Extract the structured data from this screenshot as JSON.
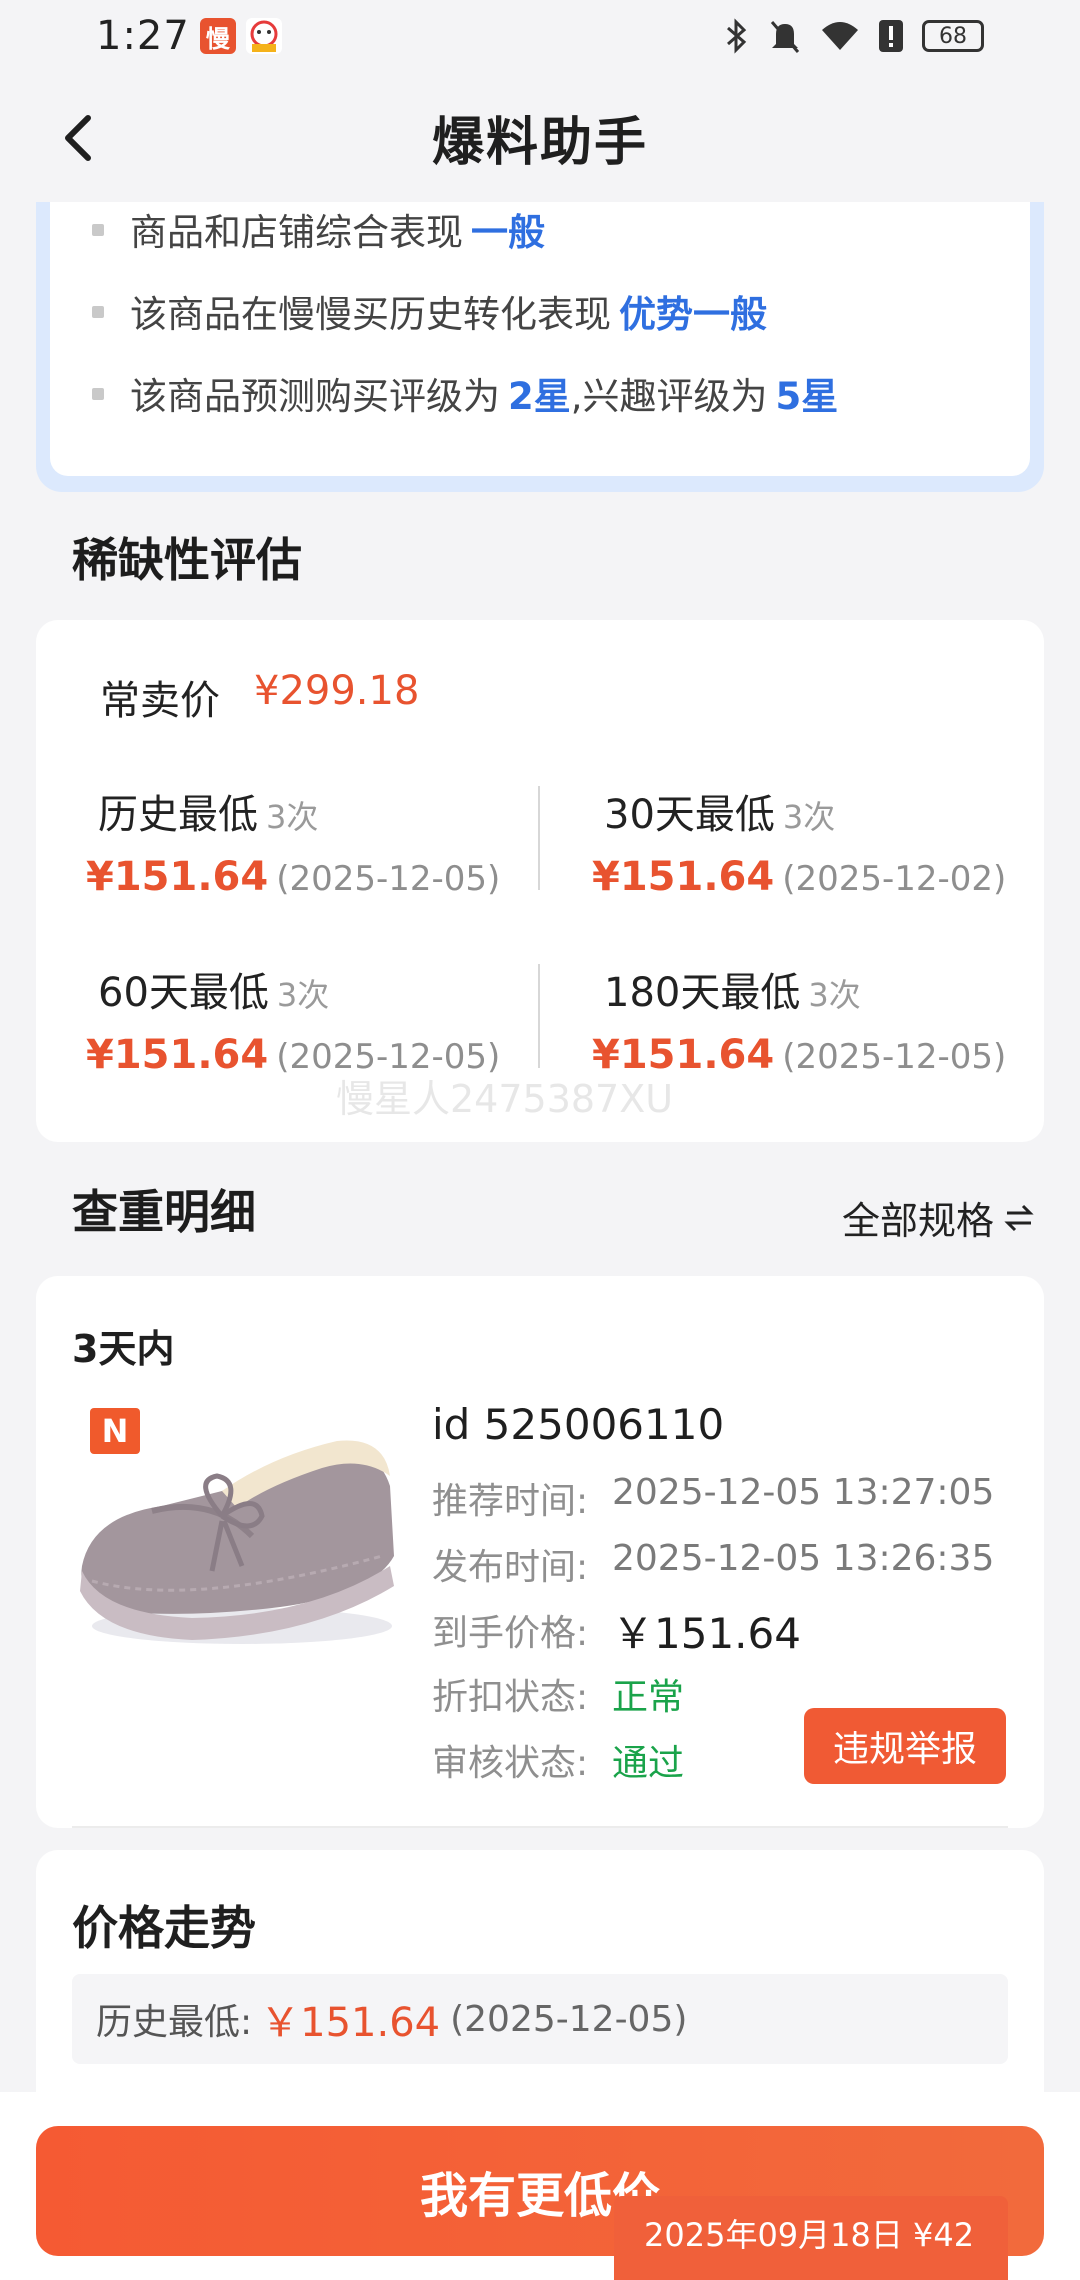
{
  "status_bar": {
    "time": "1:27",
    "battery": "68",
    "app_icon_1": "慢",
    "icons": [
      "bluetooth-icon",
      "mute-icon",
      "wifi-icon",
      "alert-icon",
      "battery-icon"
    ]
  },
  "header": {
    "title": "爆料助手"
  },
  "summary": {
    "lines": [
      {
        "text": "商品和店铺综合表现",
        "highlight": "一般"
      },
      {
        "text": "该商品在慢慢买历史转化表现",
        "highlight": "优势一般"
      },
      {
        "text_1": "该商品预测购买评级为",
        "highlight_1": "2星",
        "text_2": ",兴趣评级为",
        "highlight_2": "5星"
      }
    ]
  },
  "scarcity": {
    "title": "稀缺性评估",
    "usual_label": "常卖价",
    "usual_price": "¥299.18",
    "cells": [
      {
        "title": "历史最低",
        "count": "3次",
        "price": "¥151.64",
        "date": "(2025-12-05)"
      },
      {
        "title": "30天最低",
        "count": "3次",
        "price": "¥151.64",
        "date": "(2025-12-02)"
      },
      {
        "title": "60天最低",
        "count": "3次",
        "price": "¥151.64",
        "date": "(2025-12-05)"
      },
      {
        "title": "180天最低",
        "count": "3次",
        "price": "¥151.64",
        "date": "(2025-12-05)"
      }
    ],
    "watermark": "慢星人2475387XU"
  },
  "dedup": {
    "title": "查重明细",
    "spec_toggle": "全部规格",
    "period": "3天内",
    "badge": "N",
    "product_id": "id 525006110",
    "rows": [
      {
        "label": "推荐时间:",
        "value": "2025-12-05 13:27:05"
      },
      {
        "label": "发布时间:",
        "value": "2025-12-05 13:26:35"
      },
      {
        "label": "到手价格:",
        "value": "￥151.64"
      },
      {
        "label": "折扣状态:",
        "value": "正常"
      },
      {
        "label": "审核状态:",
        "value": "通过"
      }
    ],
    "report_button": "违规举报"
  },
  "trend": {
    "title": "价格走势",
    "label": "历史最低:",
    "price": "￥151.64",
    "date": "(2025-12-05)"
  },
  "bottom": {
    "cta": "我有更低价",
    "toast": "2025年09月18日 ¥42"
  }
}
